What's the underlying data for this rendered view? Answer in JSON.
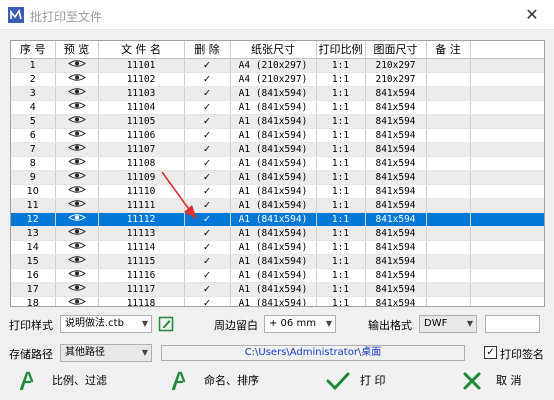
{
  "window": {
    "title": "批打印至文件",
    "close_glyph": "✕"
  },
  "columns": [
    "序 号",
    "预 览",
    "文 件 名",
    "删 除",
    "纸张尺寸",
    "打印比例",
    "图面尺寸",
    "备 注"
  ],
  "rows": [
    {
      "no": "1",
      "file": "11101",
      "paper": "A4 (210x297)",
      "scale": "1:1",
      "size": "210x297"
    },
    {
      "no": "2",
      "file": "11102",
      "paper": "A4 (210x297)",
      "scale": "1:1",
      "size": "210x297"
    },
    {
      "no": "3",
      "file": "11103",
      "paper": "A1 (841x594)",
      "scale": "1:1",
      "size": "841x594"
    },
    {
      "no": "4",
      "file": "11104",
      "paper": "A1 (841x594)",
      "scale": "1:1",
      "size": "841x594"
    },
    {
      "no": "5",
      "file": "11105",
      "paper": "A1 (841x594)",
      "scale": "1:1",
      "size": "841x594"
    },
    {
      "no": "6",
      "file": "11106",
      "paper": "A1 (841x594)",
      "scale": "1:1",
      "size": "841x594"
    },
    {
      "no": "7",
      "file": "11107",
      "paper": "A1 (841x594)",
      "scale": "1:1",
      "size": "841x594"
    },
    {
      "no": "8",
      "file": "11108",
      "paper": "A1 (841x594)",
      "scale": "1:1",
      "size": "841x594"
    },
    {
      "no": "9",
      "file": "11109",
      "paper": "A1 (841x594)",
      "scale": "1:1",
      "size": "841x594"
    },
    {
      "no": "10",
      "file": "11110",
      "paper": "A1 (841x594)",
      "scale": "1:1",
      "size": "841x594"
    },
    {
      "no": "11",
      "file": "11111",
      "paper": "A1 (841x594)",
      "scale": "1:1",
      "size": "841x594"
    },
    {
      "no": "12",
      "file": "11112",
      "paper": "A1 (841x594)",
      "scale": "1:1",
      "size": "841x594"
    },
    {
      "no": "13",
      "file": "11113",
      "paper": "A1 (841x594)",
      "scale": "1:1",
      "size": "841x594"
    },
    {
      "no": "14",
      "file": "11114",
      "paper": "A1 (841x594)",
      "scale": "1:1",
      "size": "841x594"
    },
    {
      "no": "15",
      "file": "11115",
      "paper": "A1 (841x594)",
      "scale": "1:1",
      "size": "841x594"
    },
    {
      "no": "16",
      "file": "11116",
      "paper": "A1 (841x594)",
      "scale": "1:1",
      "size": "841x594"
    },
    {
      "no": "17",
      "file": "11117",
      "paper": "A1 (841x594)",
      "scale": "1:1",
      "size": "841x594"
    },
    {
      "no": "18",
      "file": "11118",
      "paper": "A1 (841x594)",
      "scale": "1:1",
      "size": "841x594"
    }
  ],
  "selected_row": 11,
  "delete_glyph": "✓",
  "print_style": {
    "label": "打印样式",
    "value": "说明做法.ctb"
  },
  "margin": {
    "label": "周边留白",
    "value": "+ 06 mm"
  },
  "output_format": {
    "label": "输出格式",
    "value": "DWF",
    "extra": ""
  },
  "save_path": {
    "label": "存储路径",
    "value": "其他路径",
    "path": "C:\\Users\\Administrator\\桌面"
  },
  "sign": {
    "label": "打印签名",
    "checked": true,
    "check_glyph": "✓"
  },
  "buttons": {
    "filter": "比例、过滤",
    "rename": "命名、排序",
    "print": "打 印",
    "cancel": "取 消"
  },
  "colors": {
    "selected": "#0078d7",
    "accent_green": "#1e8a3a",
    "annotation_arrow": "#e03030",
    "cancel_red": "#1e8a3a",
    "path_text": "#1a3cc8"
  },
  "icons": {
    "app": "app-logo-icon",
    "preview": "eye-icon",
    "edit": "edit-icon"
  }
}
